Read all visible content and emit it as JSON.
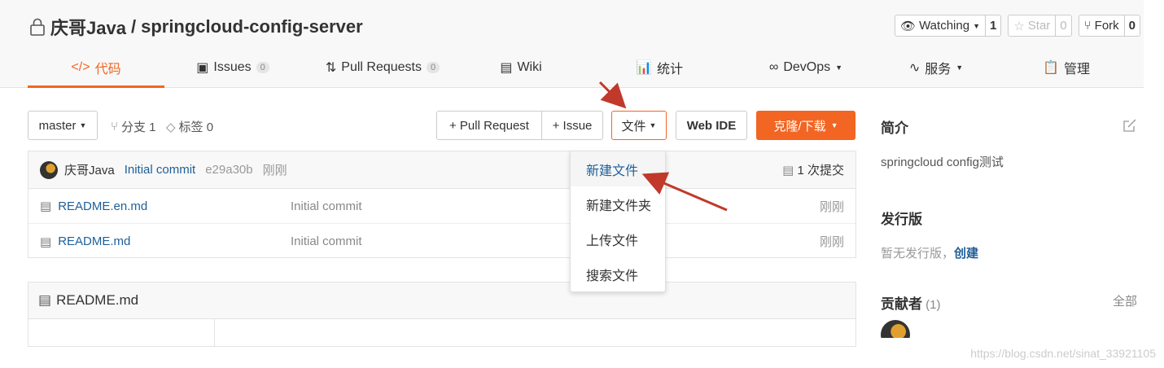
{
  "repo": {
    "owner": "庆哥Java",
    "separator": "/",
    "name": "springcloud-config-server"
  },
  "repo_actions": {
    "watch_label": "Watching",
    "watch_count": "1",
    "star_label": "Star",
    "star_count": "0",
    "fork_label": "Fork",
    "fork_count": "0"
  },
  "tabs": [
    {
      "icon": "</>",
      "label": "代码",
      "active": true
    },
    {
      "label": "Issues",
      "badge": "0"
    },
    {
      "label": "Pull Requests",
      "badge": "0"
    },
    {
      "label": "Wiki"
    },
    {
      "label": "统计"
    },
    {
      "label": "DevOps"
    },
    {
      "label": "服务"
    },
    {
      "label": "管理"
    }
  ],
  "toolbar": {
    "branch": "master",
    "branches": "分支 1",
    "tags": "标签 0",
    "pull_request": "+ Pull Request",
    "issue": "+ Issue",
    "file": "文件",
    "web_ide": "Web IDE",
    "clone": "克隆/下载"
  },
  "commit": {
    "author": "庆哥Java",
    "message": "Initial commit",
    "hash": "e29a30b",
    "time": "刚刚",
    "commits": "1 次提交"
  },
  "files": [
    {
      "name": "README.en.md",
      "message": "Initial commit",
      "time": "刚刚"
    },
    {
      "name": "README.md",
      "message": "Initial commit",
      "time": "刚刚"
    }
  ],
  "readme": {
    "title": "README.md"
  },
  "file_menu": {
    "items": [
      "新建文件",
      "新建文件夹",
      "上传文件",
      "搜索文件"
    ]
  },
  "sidebar": {
    "intro_title": "简介",
    "intro_text": "springcloud config测试",
    "release_title": "发行版",
    "release_text": "暂无发行版，",
    "release_link": "创建",
    "contrib_title": "贡献者",
    "contrib_count": "(1)",
    "contrib_all": "全部"
  },
  "watermark": "https://blog.csdn.net/sinat_33921105",
  "colors": {
    "accent": "#f26522",
    "link": "#1e5f99",
    "arrow": "#c0392b"
  }
}
